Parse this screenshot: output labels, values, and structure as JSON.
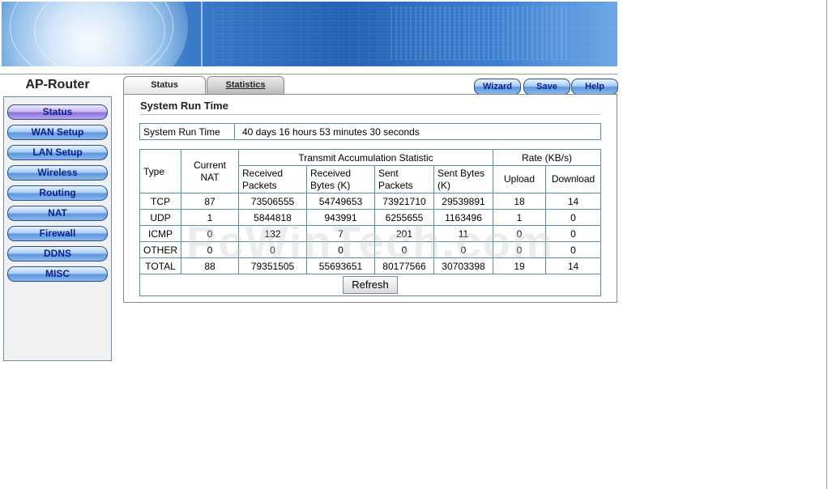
{
  "brand": "AP-Router",
  "nav": [
    {
      "label": "Status",
      "active": true
    },
    {
      "label": "WAN Setup"
    },
    {
      "label": "LAN Setup"
    },
    {
      "label": "Wireless"
    },
    {
      "label": "Routing"
    },
    {
      "label": "NAT"
    },
    {
      "label": "Firewall"
    },
    {
      "label": "DDNS"
    },
    {
      "label": "MISC"
    }
  ],
  "tabs": {
    "status": "Status",
    "statistics": "Statistics"
  },
  "toolbar": {
    "wizard": "Wizard",
    "save": "Save",
    "help": "Help"
  },
  "section_title": "System Run Time",
  "runtime": {
    "label": "System Run Time",
    "value": "40 days  16 hours  53 minutes  30 seconds"
  },
  "stats": {
    "headers": {
      "type": "Type",
      "current_nat": "Current NAT",
      "transmit": "Transmit Accumulation Statistic",
      "rate": "Rate (KB/s)",
      "received_packets": "Received Packets",
      "received_bytes": "Received Bytes (K)",
      "sent_packets": "Sent Packets",
      "sent_bytes": "Sent Bytes (K)",
      "upload": "Upload",
      "download": "Download"
    },
    "rows": [
      {
        "type": "TCP",
        "nat": "87",
        "rp": "73506555",
        "rb": "54749653",
        "sp": "73921710",
        "sb": "29539891",
        "up": "18",
        "down": "14"
      },
      {
        "type": "UDP",
        "nat": "1",
        "rp": "5844818",
        "rb": "943991",
        "sp": "6255655",
        "sb": "1163496",
        "up": "1",
        "down": "0"
      },
      {
        "type": "ICMP",
        "nat": "0",
        "rp": "132",
        "rb": "7",
        "sp": "201",
        "sb": "11",
        "up": "0",
        "down": "0"
      },
      {
        "type": "OTHER",
        "nat": "0",
        "rp": "0",
        "rb": "0",
        "sp": "0",
        "sb": "0",
        "up": "0",
        "down": "0"
      },
      {
        "type": "TOTAL",
        "nat": "88",
        "rp": "79351505",
        "rb": "55693651",
        "sp": "80177566",
        "sb": "30703398",
        "up": "19",
        "down": "14"
      }
    ]
  },
  "refresh_label": "Refresh",
  "watermark": "PcWinTech.com"
}
